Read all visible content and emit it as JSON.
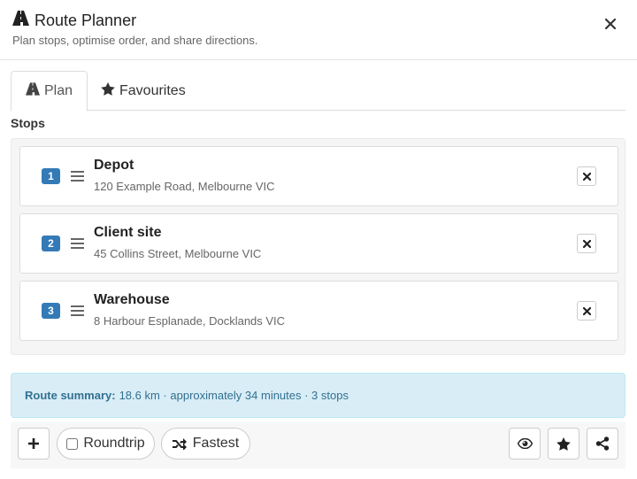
{
  "header": {
    "title": "Route Planner",
    "subtitle": "Plan stops, optimise order, and share directions.",
    "title_icon": "road-icon",
    "close_icon": "close-icon"
  },
  "tabs": [
    {
      "label": "Plan",
      "icon": "road-icon",
      "active": true
    },
    {
      "label": "Favourites",
      "icon": "star-icon",
      "active": false
    }
  ],
  "stops_section": {
    "label": "Stops",
    "stops": [
      {
        "number": "1",
        "name": "Depot",
        "address": "120 Example Road, Melbourne VIC"
      },
      {
        "number": "2",
        "name": "Client site",
        "address": "45 Collins Street, Melbourne VIC"
      },
      {
        "number": "3",
        "name": "Warehouse",
        "address": "8 Harbour Esplanade, Docklands VIC"
      }
    ]
  },
  "summary": {
    "label": "Route summary:",
    "text": "18.6 km · approximately 34 minutes · 3 stops"
  },
  "toolbar": {
    "roundtrip_label": "Roundtrip",
    "roundtrip_checked": false,
    "fastest_label": "Fastest",
    "icons": [
      "plus-icon",
      "shuffle-icon",
      "eye-icon",
      "star-icon",
      "share-icon"
    ]
  },
  "colors": {
    "badge": "#337ab7",
    "summary_bg": "#d9edf7",
    "summary_text": "#31708f"
  }
}
